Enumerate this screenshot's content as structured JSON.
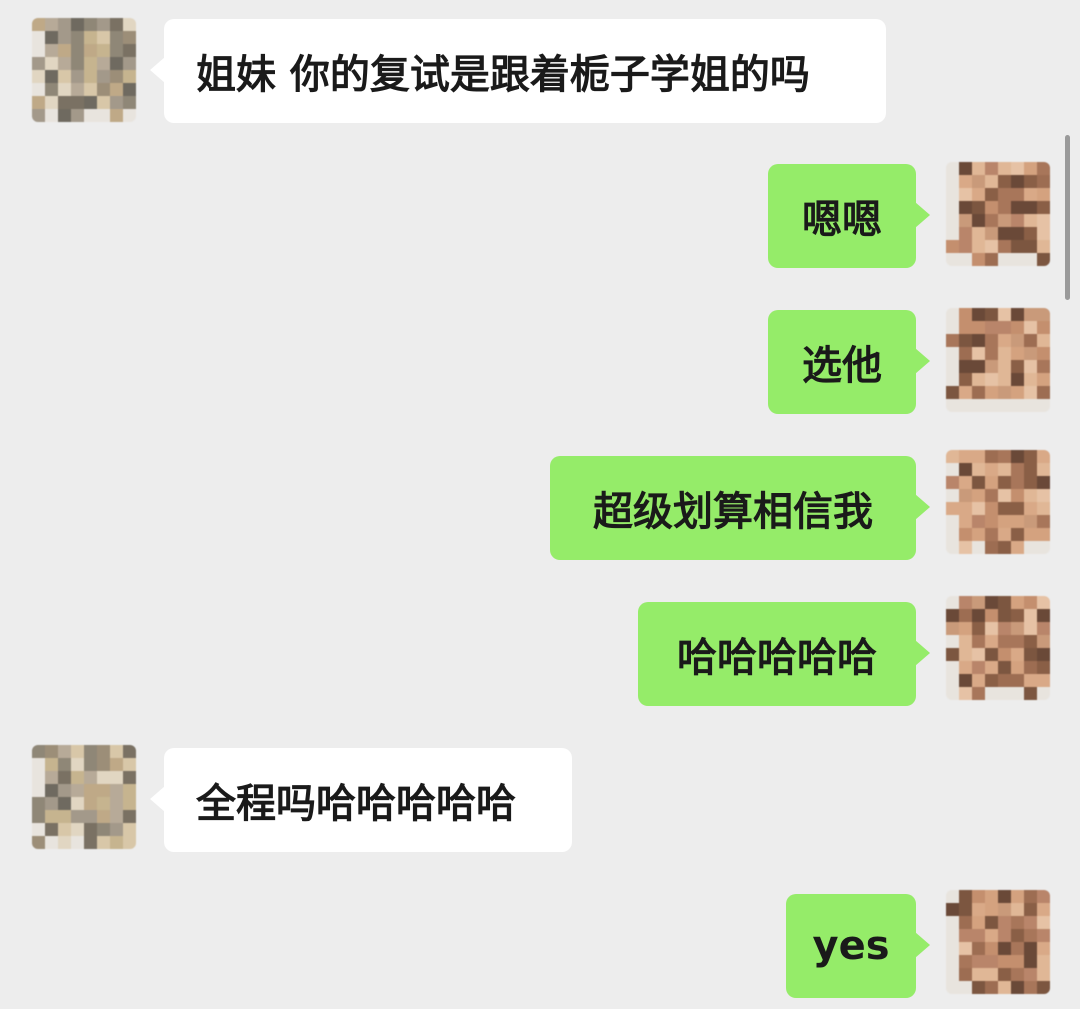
{
  "colors": {
    "background": "#ededed",
    "bubble_left": "#ffffff",
    "bubble_right": "#95ec69",
    "text": "#1a1a1a"
  },
  "messages": [
    {
      "side": "left",
      "text": "姐妹 你的复试是跟着栀子学姐的吗",
      "avatar": "pixelated-avatar-contact"
    },
    {
      "side": "right",
      "text": "嗯嗯",
      "avatar": "pixelated-avatar-self"
    },
    {
      "side": "right",
      "text": "选他",
      "avatar": "pixelated-avatar-self"
    },
    {
      "side": "right",
      "text": "超级划算相信我",
      "avatar": "pixelated-avatar-self"
    },
    {
      "side": "right",
      "text": "哈哈哈哈哈",
      "avatar": "pixelated-avatar-self"
    },
    {
      "side": "left",
      "text": "全程吗哈哈哈哈哈",
      "avatar": "pixelated-avatar-contact"
    },
    {
      "side": "right",
      "text": "yes",
      "avatar": "pixelated-avatar-self"
    }
  ]
}
